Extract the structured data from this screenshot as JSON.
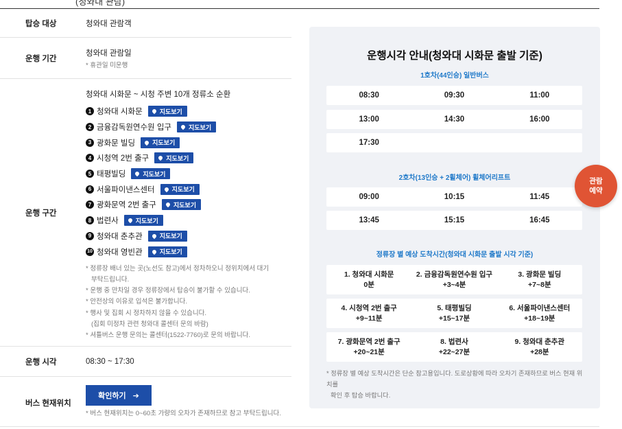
{
  "cutoff_text": "(청와대 관람)",
  "info": {
    "target_label": "탑승 대상",
    "target_value": "청와대 관람객",
    "period_label": "운행 기간",
    "period_value": "청와대 관람일",
    "period_note": "* 휴관일 미운행",
    "route_label": "운행 구간",
    "route_head": "청와대 시화문 ~ 시청 주변 10개 정류소 순환",
    "map_btn_label": "지도보기",
    "stops": [
      {
        "num": "1",
        "name": "청와대 시화문"
      },
      {
        "num": "2",
        "name": "금융감독원연수원 입구"
      },
      {
        "num": "3",
        "name": "광화문 빌딩"
      },
      {
        "num": "4",
        "name": "시청역 2번 출구"
      },
      {
        "num": "5",
        "name": "태평빌딩"
      },
      {
        "num": "6",
        "name": "서울파이낸스센터"
      },
      {
        "num": "7",
        "name": "광화문역 2번 출구"
      },
      {
        "num": "8",
        "name": "법련사"
      },
      {
        "num": "9",
        "name": "청와대 춘추관"
      },
      {
        "num": "10",
        "name": "청와대 영빈관"
      }
    ],
    "route_notes": [
      "* 정류장 배너 있는 곳(노선도 참고)에서 정차하오니 정위치에서 대기",
      "  부탁드립니다.",
      "* 운행 중 만차일 경우 정류장에서 탑승이 불가할 수 있습니다.",
      "* 안전상의 이유로 입석은 불가합니다.",
      "* 행사 및 집회 시 정차하지 않을 수 있습니다.",
      "  (집회 미정차 관련 청와대 콜센터 문의 바람)",
      "* 셔틀버스 운행 문의는 콜센터(1522-7760)로 문의 바랍니다."
    ],
    "time_label": "운행 시각",
    "time_value": "08:30 ~ 17:30",
    "bus_label": "버스 현재위치",
    "confirm_btn": "확인하기",
    "bus_note": "* 버스 현재위치는 0~60초 가량의 오차가 존재하므로 참고 부탁드립니다."
  },
  "schedule": {
    "title": "운행시각 안내(청와대 시화문 출발 기준)",
    "bus1_title": "1호차(44인승) 일반버스",
    "bus1_rows": [
      [
        "08:30",
        "09:30",
        "11:00"
      ],
      [
        "13:00",
        "14:30",
        "16:00"
      ],
      [
        "17:30",
        "",
        ""
      ]
    ],
    "bus2_title": "2호차(13인승 + 2휠체어) 휠체어리프트",
    "bus2_rows": [
      [
        "09:00",
        "10:15",
        "11:45"
      ],
      [
        "13:45",
        "15:15",
        "16:45"
      ]
    ],
    "arrival_title": "정류장 별 예상 도착시간(청와대 시화문 출발 시각 기준)",
    "arrival_rows": [
      [
        {
          "name": "1. 청와대 시화문",
          "time": "0분"
        },
        {
          "name": "2. 금융감독원연수원 입구",
          "time": "+3~4분"
        },
        {
          "name": "3. 광화문 빌딩",
          "time": "+7~8분"
        }
      ],
      [
        {
          "name": "4. 시청역 2번 출구",
          "time": "+9~11분"
        },
        {
          "name": "5. 태평빌딩",
          "time": "+15~17분"
        },
        {
          "name": "6. 서울파이낸스센터",
          "time": "+18~19분"
        }
      ],
      [
        {
          "name": "7. 광화문역 2번 출구",
          "time": "+20~21분"
        },
        {
          "name": "8. 법련사",
          "time": "+22~27분"
        },
        {
          "name": "9. 청와대 춘추관",
          "time": "+28분"
        }
      ]
    ],
    "note_line1": "* 정류장 별 예상 도착시간은 단순 참고용입니다. 도로상황에 따라 오차기 존재하므로 버스 현재 위치를",
    "note_line2": "  확인 후 탑승 바랍니다."
  },
  "fab": {
    "line1": "관람",
    "line2": "예약"
  },
  "colors": {
    "primary": "#1d4ea8",
    "accent_text": "#1f79c9",
    "fab": "#e05434",
    "panel_bg": "#f0f2f6"
  }
}
